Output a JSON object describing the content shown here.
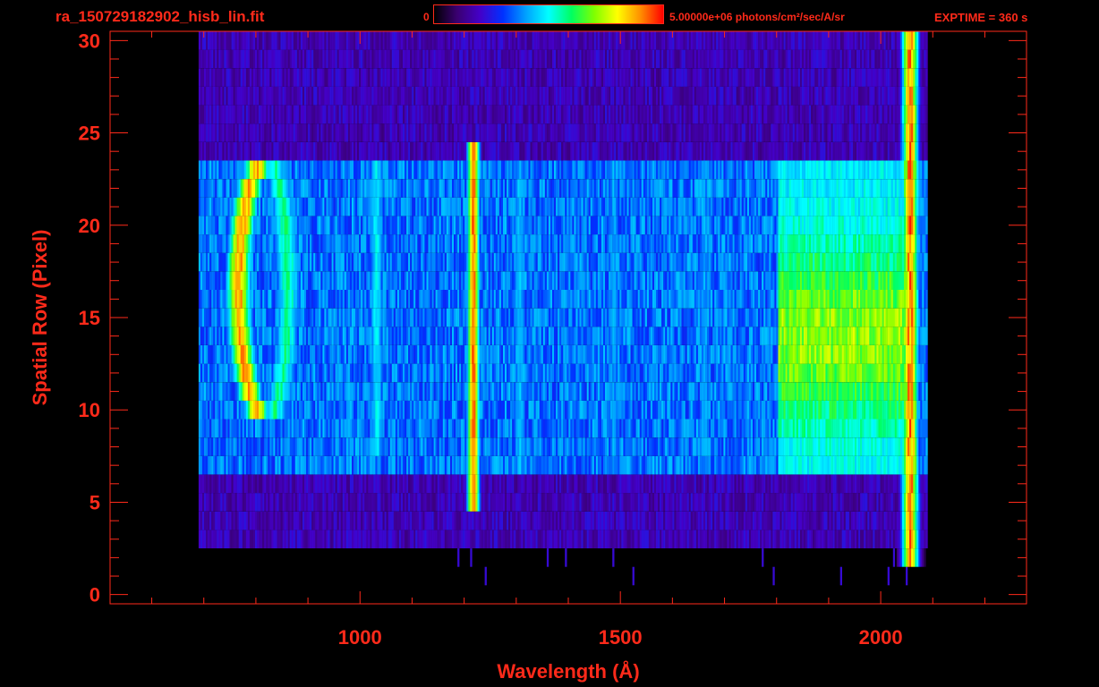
{
  "header": {
    "file_name": "ra_150729182902_hisb_lin.fit",
    "colorbar_min": "0",
    "colorbar_max": "5.00000e+06 photons/cm²/sec/A/sr",
    "exptime": "EXPTIME = 360 s"
  },
  "colors": {
    "axis": "#ff2a1a",
    "background": "#000000",
    "colormap": [
      "#000000",
      "#3a0070",
      "#4400c8",
      "#0030ff",
      "#00a0ff",
      "#00ffff",
      "#00ff60",
      "#80ff00",
      "#ffff00",
      "#ff9000",
      "#ff0000"
    ]
  },
  "chart_data": {
    "type": "heatmap",
    "title": "ra_150729182902_hisb_lin.fit",
    "xlabel": "Wavelength (Å)",
    "ylabel": "Spatial Row (Pixel)",
    "xlim": [
      520,
      2280
    ],
    "ylim": [
      -0.5,
      30.5
    ],
    "xticks": [
      1000,
      1500,
      2000
    ],
    "yticks": [
      0,
      5,
      10,
      15,
      20,
      25,
      30
    ],
    "colorbar": {
      "min": 0,
      "max": 5000000,
      "units": "photons/cm²/sec/A/sr"
    },
    "signal_region": {
      "x": [
        690,
        2090
      ],
      "rows_faint": [
        3,
        30
      ],
      "rows_bright": [
        7,
        23
      ]
    },
    "features": [
      {
        "name": "arc",
        "x_center": 820,
        "rows": [
          10,
          23
        ],
        "peak_fraction": 0.95
      },
      {
        "name": "band",
        "x": 1030,
        "rows": [
          8,
          23
        ],
        "peak_fraction": 0.5
      },
      {
        "name": "line",
        "x": 1216,
        "rows": [
          5,
          24
        ],
        "peak_fraction": 0.98
      },
      {
        "name": "band",
        "x": 1305,
        "rows": [
          7,
          23
        ],
        "peak_fraction": 0.45
      },
      {
        "name": "band",
        "x": 1485,
        "rows": [
          7,
          23
        ],
        "peak_fraction": 0.42
      },
      {
        "name": "band",
        "x": 1660,
        "rows": [
          7,
          23
        ],
        "peak_fraction": 0.42
      },
      {
        "name": "continuum",
        "x": [
          1800,
          2060
        ],
        "rows": [
          7,
          23
        ],
        "peak_fraction": 0.7
      },
      {
        "name": "edge",
        "x": 2055,
        "rows": [
          2,
          30
        ],
        "peak_fraction": 0.95
      }
    ]
  }
}
